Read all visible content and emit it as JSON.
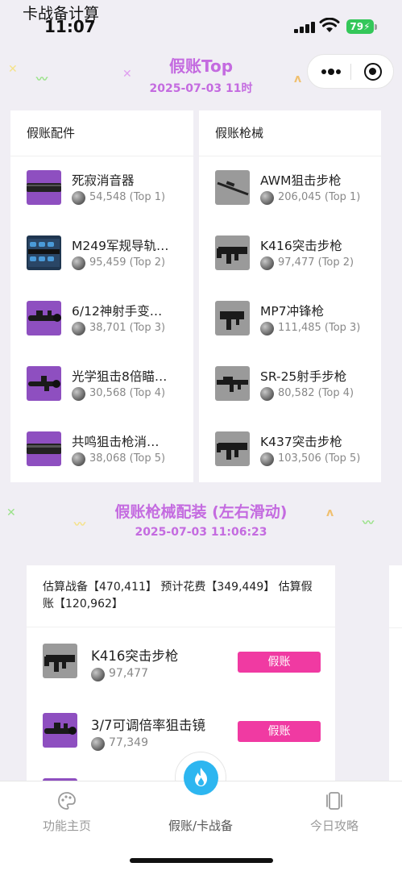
{
  "status_bar": {
    "app_name": "卡战备计算",
    "time": "11:07",
    "battery": "79"
  },
  "header": {
    "title": "假账Top",
    "date": "2025-07-03 11时"
  },
  "accessories_card": {
    "title": "假账配件",
    "items": [
      {
        "name": "死寂消音器",
        "value": "54,548 (Top 1)"
      },
      {
        "name": "M249军规导轨…",
        "value": "95,459 (Top 2)"
      },
      {
        "name": "6/12神射手变…",
        "value": "38,701 (Top 3)"
      },
      {
        "name": "光学狙击8倍瞄…",
        "value": "30,568 (Top 4)"
      },
      {
        "name": "共鸣狙击枪消…",
        "value": "38,068 (Top 5)"
      }
    ]
  },
  "guns_card": {
    "title": "假账枪械",
    "items": [
      {
        "name": "AWM狙击步枪",
        "value": "206,045 (Top 1)"
      },
      {
        "name": "K416突击步枪",
        "value": "97,477 (Top 2)"
      },
      {
        "name": "MP7冲锋枪",
        "value": "111,485 (Top 3)"
      },
      {
        "name": "SR-25射手步枪",
        "value": "80,582 (Top 4)"
      },
      {
        "name": "K437突击步枪",
        "value": "103,506 (Top 5)"
      }
    ]
  },
  "loadout_section": {
    "title": "假账枪械配装 (左右滑动)",
    "date": "2025-07-03 11:06:23",
    "summary": "估算战备【470,411】 预计花费【349,449】 估算假账【120,962】",
    "items": [
      {
        "name": "K416突击步枪",
        "value": "97,477",
        "button": "假账"
      },
      {
        "name": "3/7可调倍率狙击镜",
        "value": "77,349",
        "button": "假账"
      }
    ]
  },
  "tab_bar": {
    "tabs": [
      {
        "label": "功能主页",
        "icon": "palette-icon"
      },
      {
        "label": "假账/卡战备",
        "icon": "flame-icon"
      },
      {
        "label": "今日攻略",
        "icon": "cards-icon"
      }
    ]
  },
  "colors": {
    "accent_purple": "#c46be0",
    "button_pink": "#f03aa2",
    "center_tab_blue": "#2db6f0",
    "battery_green": "#34c759"
  }
}
